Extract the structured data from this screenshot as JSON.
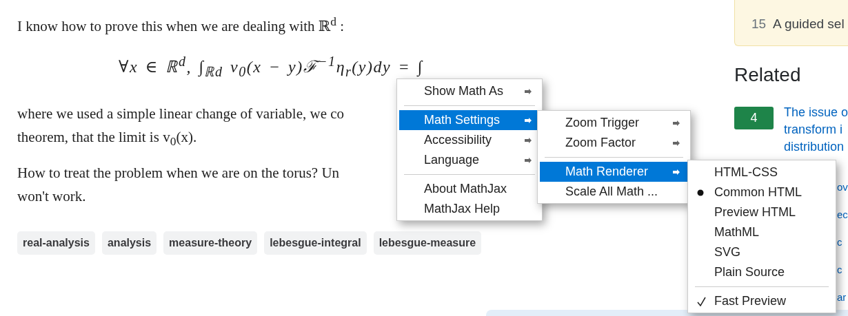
{
  "post": {
    "intro": "I know how to prove this when we are dealing with ℝ$^{d}$ :",
    "formula": "∀x ∈ ℝ$^{d}$, ∫$_{ℝd}$ v$_{0}$(x − y)ℱ$^{−1}$η$_{r}$(y)dy = ∫",
    "paragraphs": [
      [
        "where we used a simple linear change of variable, we co",
        "theorem, that the limit is v$_{0}$(x)."
      ],
      [
        "How to treat the problem when we are on the torus? Un",
        "won't work."
      ]
    ],
    "tags": [
      "real-analysis",
      "analysis",
      "measure-theory",
      "lebesgue-integral",
      "lebesgue-measure"
    ]
  },
  "sidebar": {
    "featured": {
      "count": "15",
      "title": "A guided sel"
    },
    "related_heading": "Related",
    "related": [
      {
        "score": "4",
        "lines": [
          "The issue o",
          "transform i",
          "distribution"
        ]
      }
    ],
    "fragments": [
      "ov",
      "ec",
      "c",
      "c",
      "ar"
    ]
  },
  "menus": [
    {
      "items": [
        {
          "kind": "submenu",
          "label": "Show Math As",
          "selected": false
        },
        {
          "kind": "separator"
        },
        {
          "kind": "submenu",
          "label": "Math Settings",
          "selected": true
        },
        {
          "kind": "submenu",
          "label": "Accessibility",
          "selected": false
        },
        {
          "kind": "submenu",
          "label": "Language",
          "selected": false
        },
        {
          "kind": "separator"
        },
        {
          "kind": "action",
          "label": "About MathJax",
          "selected": false
        },
        {
          "kind": "action",
          "label": "MathJax Help",
          "selected": false
        }
      ]
    },
    {
      "items": [
        {
          "kind": "submenu",
          "label": "Zoom Trigger",
          "selected": false
        },
        {
          "kind": "submenu",
          "label": "Zoom Factor",
          "selected": false
        },
        {
          "kind": "separator"
        },
        {
          "kind": "submenu",
          "label": "Math Renderer",
          "selected": true
        },
        {
          "kind": "action",
          "label": "Scale All Math ...",
          "selected": false
        }
      ]
    },
    {
      "items": [
        {
          "kind": "radio",
          "label": "HTML-CSS",
          "selected": false
        },
        {
          "kind": "radio",
          "label": "Common HTML",
          "selected": true
        },
        {
          "kind": "radio",
          "label": "Preview HTML",
          "selected": false
        },
        {
          "kind": "radio",
          "label": "MathML",
          "selected": false
        },
        {
          "kind": "radio",
          "label": "SVG",
          "selected": false
        },
        {
          "kind": "radio",
          "label": "Plain Source",
          "selected": false
        },
        {
          "kind": "separator"
        },
        {
          "kind": "check",
          "label": "Fast Preview",
          "checked": true
        }
      ]
    }
  ]
}
